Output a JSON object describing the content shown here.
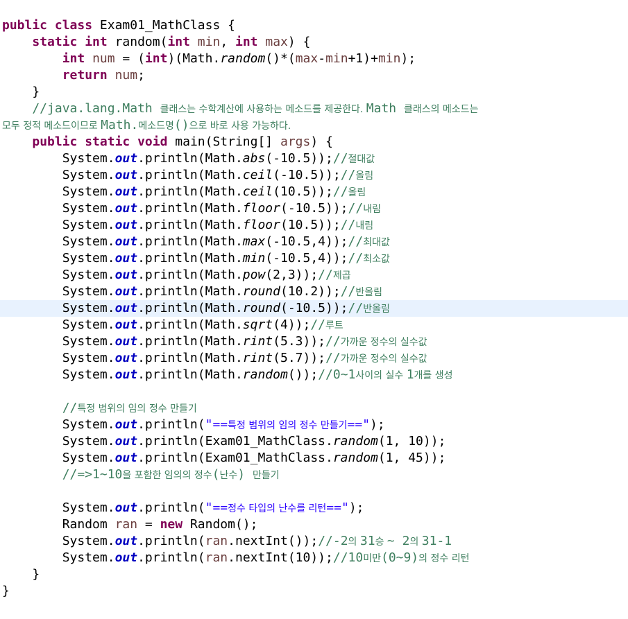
{
  "editor": {
    "current_line_index": 17,
    "lines": [
      [
        {
          "t": "public class ",
          "c": "kw"
        },
        {
          "t": "Exam01_MathClass {",
          "c": ""
        }
      ],
      [
        {
          "t": "    ",
          "c": ""
        },
        {
          "t": "static int ",
          "c": "kw"
        },
        {
          "t": "random(",
          "c": ""
        },
        {
          "t": "int ",
          "c": "kw"
        },
        {
          "t": "min",
          "c": "var"
        },
        {
          "t": ", ",
          "c": ""
        },
        {
          "t": "int ",
          "c": "kw"
        },
        {
          "t": "max",
          "c": "var"
        },
        {
          "t": ") {",
          "c": ""
        }
      ],
      [
        {
          "t": "        ",
          "c": ""
        },
        {
          "t": "int ",
          "c": "kw"
        },
        {
          "t": "num",
          "c": "var"
        },
        {
          "t": " = (",
          "c": ""
        },
        {
          "t": "int",
          "c": "kw"
        },
        {
          "t": ")(Math.",
          "c": ""
        },
        {
          "t": "random",
          "c": "method-static"
        },
        {
          "t": "()*(",
          "c": ""
        },
        {
          "t": "max",
          "c": "var"
        },
        {
          "t": "-",
          "c": ""
        },
        {
          "t": "min",
          "c": "var"
        },
        {
          "t": "+1)+",
          "c": ""
        },
        {
          "t": "min",
          "c": "var"
        },
        {
          "t": ");",
          "c": ""
        }
      ],
      [
        {
          "t": "        ",
          "c": ""
        },
        {
          "t": "return ",
          "c": "kw"
        },
        {
          "t": "num",
          "c": "var"
        },
        {
          "t": ";",
          "c": ""
        }
      ],
      [
        {
          "t": "    }",
          "c": ""
        }
      ],
      [
        {
          "t": "    //java.lang.Math ",
          "c": "cm"
        },
        {
          "t": "클래스는 수학계산에 사용하는 메소드를 제공한다. ",
          "c": "cm cm-ko"
        },
        {
          "t": "Math ",
          "c": "cm"
        },
        {
          "t": "클래스의 메소드는",
          "c": "cm cm-ko"
        }
      ],
      [
        {
          "t": "모두 정적 메소드이므로 ",
          "c": "cm cm-ko"
        },
        {
          "t": "Math.",
          "c": "cm"
        },
        {
          "t": "메소드명",
          "c": "cm cm-ko"
        },
        {
          "t": "()",
          "c": "cm"
        },
        {
          "t": "으로 바로 사용 가능하다.",
          "c": "cm cm-ko"
        }
      ],
      [
        {
          "t": "    ",
          "c": ""
        },
        {
          "t": "public static void ",
          "c": "kw"
        },
        {
          "t": "main(String[] ",
          "c": ""
        },
        {
          "t": "args",
          "c": "var"
        },
        {
          "t": ") {",
          "c": ""
        }
      ],
      [
        {
          "t": "        System.",
          "c": ""
        },
        {
          "t": "out",
          "c": "field"
        },
        {
          "t": ".println(Math.",
          "c": ""
        },
        {
          "t": "abs",
          "c": "method-static"
        },
        {
          "t": "(-10.5));",
          "c": ""
        },
        {
          "t": "//",
          "c": "cm"
        },
        {
          "t": "절대값",
          "c": "cm cm-ko"
        }
      ],
      [
        {
          "t": "        System.",
          "c": ""
        },
        {
          "t": "out",
          "c": "field"
        },
        {
          "t": ".println(Math.",
          "c": ""
        },
        {
          "t": "ceil",
          "c": "method-static"
        },
        {
          "t": "(-10.5));",
          "c": ""
        },
        {
          "t": "//",
          "c": "cm"
        },
        {
          "t": "올림",
          "c": "cm cm-ko"
        }
      ],
      [
        {
          "t": "        System.",
          "c": ""
        },
        {
          "t": "out",
          "c": "field"
        },
        {
          "t": ".println(Math.",
          "c": ""
        },
        {
          "t": "ceil",
          "c": "method-static"
        },
        {
          "t": "(10.5));",
          "c": ""
        },
        {
          "t": "//",
          "c": "cm"
        },
        {
          "t": "올림",
          "c": "cm cm-ko"
        }
      ],
      [
        {
          "t": "        System.",
          "c": ""
        },
        {
          "t": "out",
          "c": "field"
        },
        {
          "t": ".println(Math.",
          "c": ""
        },
        {
          "t": "floor",
          "c": "method-static"
        },
        {
          "t": "(-10.5));",
          "c": ""
        },
        {
          "t": "//",
          "c": "cm"
        },
        {
          "t": "내림",
          "c": "cm cm-ko"
        }
      ],
      [
        {
          "t": "        System.",
          "c": ""
        },
        {
          "t": "out",
          "c": "field"
        },
        {
          "t": ".println(Math.",
          "c": ""
        },
        {
          "t": "floor",
          "c": "method-static"
        },
        {
          "t": "(10.5));",
          "c": ""
        },
        {
          "t": "//",
          "c": "cm"
        },
        {
          "t": "내림",
          "c": "cm cm-ko"
        }
      ],
      [
        {
          "t": "        System.",
          "c": ""
        },
        {
          "t": "out",
          "c": "field"
        },
        {
          "t": ".println(Math.",
          "c": ""
        },
        {
          "t": "max",
          "c": "method-static"
        },
        {
          "t": "(-10.5,4));",
          "c": ""
        },
        {
          "t": "//",
          "c": "cm"
        },
        {
          "t": "최대값",
          "c": "cm cm-ko"
        }
      ],
      [
        {
          "t": "        System.",
          "c": ""
        },
        {
          "t": "out",
          "c": "field"
        },
        {
          "t": ".println(Math.",
          "c": ""
        },
        {
          "t": "min",
          "c": "method-static"
        },
        {
          "t": "(-10.5,4));",
          "c": ""
        },
        {
          "t": "//",
          "c": "cm"
        },
        {
          "t": "최소값",
          "c": "cm cm-ko"
        }
      ],
      [
        {
          "t": "        System.",
          "c": ""
        },
        {
          "t": "out",
          "c": "field"
        },
        {
          "t": ".println(Math.",
          "c": ""
        },
        {
          "t": "pow",
          "c": "method-static"
        },
        {
          "t": "(2,3));",
          "c": ""
        },
        {
          "t": "//",
          "c": "cm"
        },
        {
          "t": "제곱",
          "c": "cm cm-ko"
        }
      ],
      [
        {
          "t": "        System.",
          "c": ""
        },
        {
          "t": "out",
          "c": "field"
        },
        {
          "t": ".println(Math.",
          "c": ""
        },
        {
          "t": "round",
          "c": "method-static"
        },
        {
          "t": "(10.2));",
          "c": ""
        },
        {
          "t": "//",
          "c": "cm"
        },
        {
          "t": "반올림",
          "c": "cm cm-ko"
        }
      ],
      [
        {
          "t": "        System.",
          "c": ""
        },
        {
          "t": "out",
          "c": "field"
        },
        {
          "t": ".println(Math.",
          "c": ""
        },
        {
          "t": "round",
          "c": "method-static"
        },
        {
          "t": "(-10.5));",
          "c": ""
        },
        {
          "t": "//",
          "c": "cm"
        },
        {
          "t": "반올림",
          "c": "cm cm-ko"
        }
      ],
      [
        {
          "t": "        System.",
          "c": ""
        },
        {
          "t": "out",
          "c": "field"
        },
        {
          "t": ".println(Math.",
          "c": ""
        },
        {
          "t": "sqrt",
          "c": "method-static"
        },
        {
          "t": "(4));",
          "c": ""
        },
        {
          "t": "//",
          "c": "cm"
        },
        {
          "t": "루트",
          "c": "cm cm-ko"
        }
      ],
      [
        {
          "t": "        System.",
          "c": ""
        },
        {
          "t": "out",
          "c": "field"
        },
        {
          "t": ".println(Math.",
          "c": ""
        },
        {
          "t": "rint",
          "c": "method-static"
        },
        {
          "t": "(5.3));",
          "c": ""
        },
        {
          "t": "//",
          "c": "cm"
        },
        {
          "t": "가까운 정수의 실수값",
          "c": "cm cm-ko"
        }
      ],
      [
        {
          "t": "        System.",
          "c": ""
        },
        {
          "t": "out",
          "c": "field"
        },
        {
          "t": ".println(Math.",
          "c": ""
        },
        {
          "t": "rint",
          "c": "method-static"
        },
        {
          "t": "(5.7));",
          "c": ""
        },
        {
          "t": "//",
          "c": "cm"
        },
        {
          "t": "가까운 정수의 실수값",
          "c": "cm cm-ko"
        }
      ],
      [
        {
          "t": "        System.",
          "c": ""
        },
        {
          "t": "out",
          "c": "field"
        },
        {
          "t": ".println(Math.",
          "c": ""
        },
        {
          "t": "random",
          "c": "method-static"
        },
        {
          "t": "());",
          "c": ""
        },
        {
          "t": "//0~1",
          "c": "cm"
        },
        {
          "t": "사이의 실수 ",
          "c": "cm cm-ko"
        },
        {
          "t": "1",
          "c": "cm"
        },
        {
          "t": "개를 생성",
          "c": "cm cm-ko"
        }
      ],
      [
        {
          "t": "",
          "c": ""
        }
      ],
      [
        {
          "t": "        //",
          "c": "cm"
        },
        {
          "t": "특정 범위의 임의 정수 만들기",
          "c": "cm cm-ko"
        }
      ],
      [
        {
          "t": "        System.",
          "c": ""
        },
        {
          "t": "out",
          "c": "field"
        },
        {
          "t": ".println(",
          "c": ""
        },
        {
          "t": "\"==",
          "c": "str"
        },
        {
          "t": "특정 범위의 임의 정수 만들기",
          "c": "str str-ko"
        },
        {
          "t": "==\"",
          "c": "str"
        },
        {
          "t": ");",
          "c": ""
        }
      ],
      [
        {
          "t": "        System.",
          "c": ""
        },
        {
          "t": "out",
          "c": "field"
        },
        {
          "t": ".println(Exam01_MathClass.",
          "c": ""
        },
        {
          "t": "random",
          "c": "method-static"
        },
        {
          "t": "(1, 10));",
          "c": ""
        }
      ],
      [
        {
          "t": "        System.",
          "c": ""
        },
        {
          "t": "out",
          "c": "field"
        },
        {
          "t": ".println(Exam01_MathClass.",
          "c": ""
        },
        {
          "t": "random",
          "c": "method-static"
        },
        {
          "t": "(1, 45));",
          "c": ""
        }
      ],
      [
        {
          "t": "        //=>1~10",
          "c": "cm"
        },
        {
          "t": "을 포함한 임의의 정수",
          "c": "cm cm-ko"
        },
        {
          "t": "(",
          "c": "cm"
        },
        {
          "t": "난수",
          "c": "cm cm-ko"
        },
        {
          "t": ") ",
          "c": "cm"
        },
        {
          "t": "만들기",
          "c": "cm cm-ko"
        }
      ],
      [
        {
          "t": "",
          "c": ""
        }
      ],
      [
        {
          "t": "        System.",
          "c": ""
        },
        {
          "t": "out",
          "c": "field"
        },
        {
          "t": ".println(",
          "c": ""
        },
        {
          "t": "\"==",
          "c": "str"
        },
        {
          "t": "정수 타입의 난수를 리턴",
          "c": "str str-ko"
        },
        {
          "t": "==\"",
          "c": "str"
        },
        {
          "t": ");",
          "c": ""
        }
      ],
      [
        {
          "t": "        Random ",
          "c": ""
        },
        {
          "t": "ran",
          "c": "var"
        },
        {
          "t": " = ",
          "c": ""
        },
        {
          "t": "new ",
          "c": "kw"
        },
        {
          "t": "Random();",
          "c": ""
        }
      ],
      [
        {
          "t": "        System.",
          "c": ""
        },
        {
          "t": "out",
          "c": "field"
        },
        {
          "t": ".println(",
          "c": ""
        },
        {
          "t": "ran",
          "c": "var"
        },
        {
          "t": ".nextInt());",
          "c": ""
        },
        {
          "t": "//-2",
          "c": "cm"
        },
        {
          "t": "의 ",
          "c": "cm cm-ko"
        },
        {
          "t": "31",
          "c": "cm"
        },
        {
          "t": "승 ",
          "c": "cm cm-ko"
        },
        {
          "t": "~ 2",
          "c": "cm"
        },
        {
          "t": "의 ",
          "c": "cm cm-ko"
        },
        {
          "t": "31-1",
          "c": "cm"
        }
      ],
      [
        {
          "t": "        System.",
          "c": ""
        },
        {
          "t": "out",
          "c": "field"
        },
        {
          "t": ".println(",
          "c": ""
        },
        {
          "t": "ran",
          "c": "var"
        },
        {
          "t": ".nextInt(10));",
          "c": ""
        },
        {
          "t": "//10",
          "c": "cm"
        },
        {
          "t": "미만",
          "c": "cm cm-ko"
        },
        {
          "t": "(0~9)",
          "c": "cm"
        },
        {
          "t": "의 정수 리턴",
          "c": "cm cm-ko"
        }
      ],
      [
        {
          "t": "    }",
          "c": ""
        }
      ],
      [
        {
          "t": "}",
          "c": ""
        }
      ]
    ]
  }
}
